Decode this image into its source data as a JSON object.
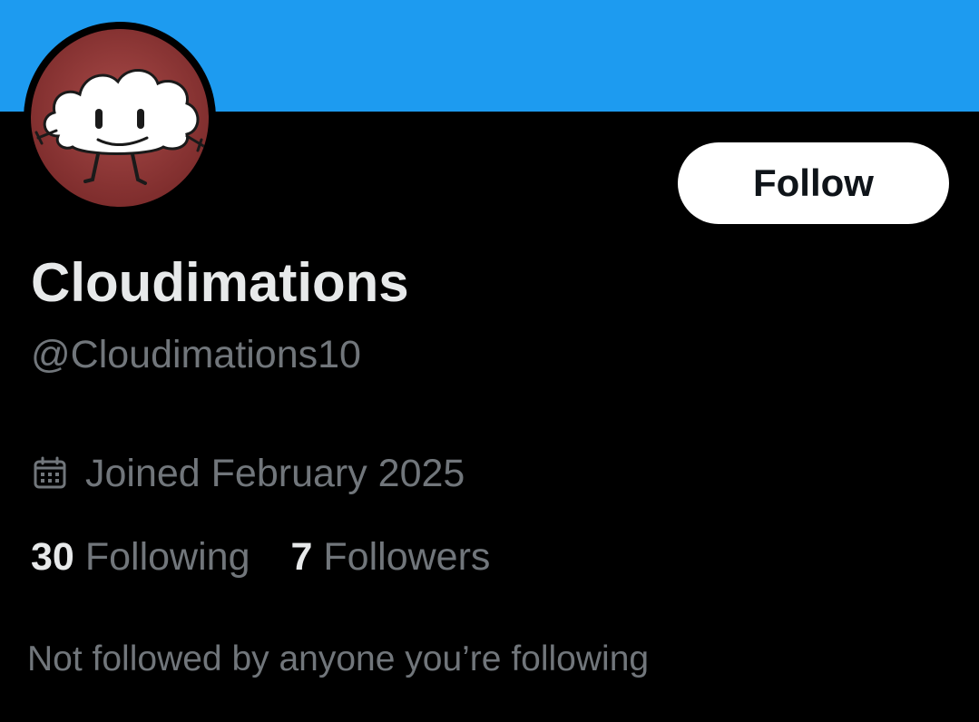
{
  "colors": {
    "banner": "#1d9bf0",
    "background": "#000000",
    "primary_text": "#e7e9ea",
    "secondary_text": "#71767b",
    "follow_button_bg": "#ffffff",
    "follow_button_text": "#0f1419"
  },
  "profile": {
    "avatar_icon": "cloud-character-avatar",
    "display_name": "Cloudimations",
    "handle": "@Cloudimations10",
    "joined_icon": "calendar-icon",
    "joined": "Joined February 2025",
    "follow_label": "Follow",
    "following_count": "30",
    "following_label": "Following",
    "followers_count": "7",
    "followers_label": "Followers",
    "not_followed_note": "Not followed by anyone you’re following"
  }
}
